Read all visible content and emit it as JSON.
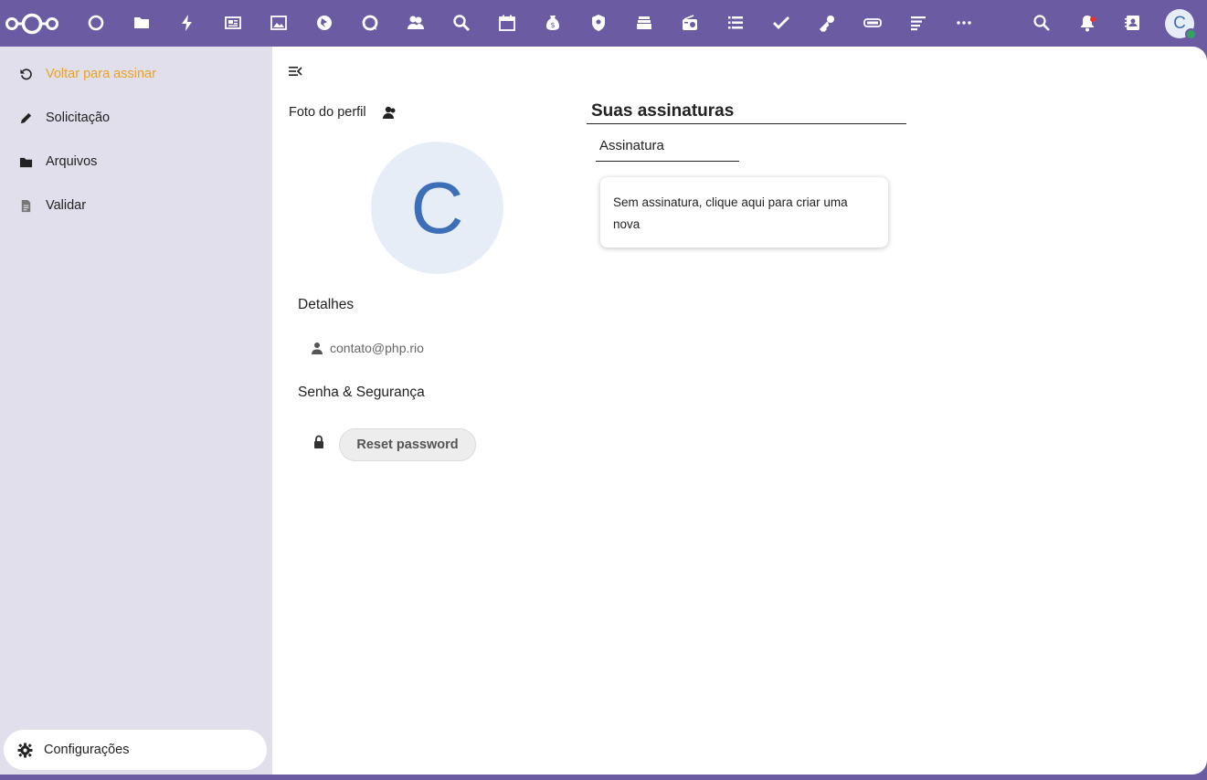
{
  "topbar": {
    "apps": [
      {
        "name": "dashboard-icon"
      },
      {
        "name": "files-icon"
      },
      {
        "name": "activity-icon"
      },
      {
        "name": "news-icon"
      },
      {
        "name": "photos-icon"
      },
      {
        "name": "maps-icon"
      },
      {
        "name": "talk-icon"
      },
      {
        "name": "contacts-icon"
      },
      {
        "name": "search-app-icon"
      },
      {
        "name": "calendar-icon"
      },
      {
        "name": "cospend-icon"
      },
      {
        "name": "shield-icon"
      },
      {
        "name": "deck-icon"
      },
      {
        "name": "radio-icon"
      },
      {
        "name": "tasks-icon"
      },
      {
        "name": "checkmark-icon"
      },
      {
        "name": "passwords-icon"
      },
      {
        "name": "ticket-icon"
      },
      {
        "name": "notes-icon"
      },
      {
        "name": "more-apps-icon"
      }
    ],
    "avatar_initial": "C",
    "accent": "#6a5ba3"
  },
  "sidebar": {
    "items": [
      {
        "label": "Voltar para assinar",
        "icon": "undo-icon",
        "active": true
      },
      {
        "label": "Solicitação",
        "icon": "pencil-icon"
      },
      {
        "label": "Arquivos",
        "icon": "folder-icon"
      },
      {
        "label": "Validar",
        "icon": "document-icon"
      }
    ],
    "settings_label": "Configurações",
    "active_color": "#e9a323"
  },
  "profile": {
    "photo_label": "Foto do perfil",
    "avatar_initial": "C",
    "details_title": "Detalhes",
    "email": "contato@php.rio",
    "security_title": "Senha & Segurança",
    "reset_button": "Reset password"
  },
  "signatures": {
    "title": "Suas assinaturas",
    "tab_label": "Assinatura",
    "empty_message": "Sem assinatura, clique aqui para criar uma nova"
  }
}
